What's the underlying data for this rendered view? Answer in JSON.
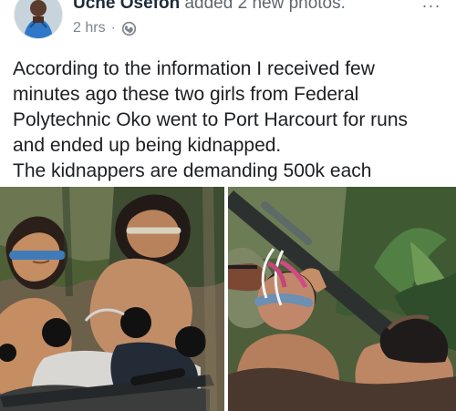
{
  "post": {
    "author": "Uche Osefoh",
    "action": "added 2 new photos.",
    "time": "2 hrs",
    "separator": "·",
    "audience_icon": "globe-icon",
    "menu": "...",
    "text": "According to the information I received few\nminutes ago these two girls from Federal\nPolytechnic Oko went to Port Harcourt for runs\nand ended up being kidnapped.\nThe kidnappers are demanding 500k each"
  },
  "photos": [
    {
      "name": "photo-1"
    },
    {
      "name": "photo-2"
    }
  ],
  "colors": {
    "author": "#1f2b3a",
    "meta": "#7c8591",
    "text": "#1c1e21",
    "background": "#ffffff"
  }
}
